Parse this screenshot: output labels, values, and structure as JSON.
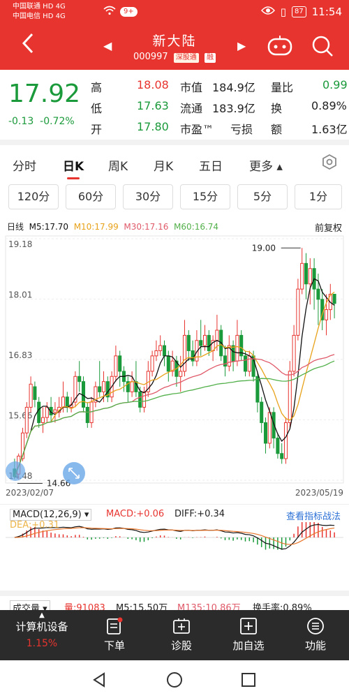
{
  "status": {
    "carrier1": "中国联通 HD 4G",
    "carrier2": "中国电信 HD 4G",
    "notif_badge": "9+",
    "battery": "87",
    "time": "11:54"
  },
  "header": {
    "back_icon": "back-arrow-icon",
    "title": "新大陆",
    "code": "000997",
    "tag_sgt": "深股通",
    "tag_rong": "融"
  },
  "quote": {
    "price": "17.92",
    "change": "-0.13",
    "change_pct": "-0.72%",
    "high_label": "高",
    "high": "18.08",
    "low_label": "低",
    "low": "17.63",
    "open_label": "开",
    "open": "17.80",
    "mcap_label": "市值",
    "mcap": "184.9亿",
    "float_label": "流通",
    "float": "183.9亿",
    "pe_label": "市盈™",
    "pe": "亏损",
    "vr_label": "量比",
    "vr": "0.99",
    "turn_label": "换",
    "turn": "0.89%",
    "amt_label": "额",
    "amt": "1.63亿"
  },
  "tabs": [
    "分时",
    "日K",
    "周K",
    "月K",
    "五日",
    "更多 ▴"
  ],
  "periods": [
    "120分",
    "60分",
    "30分",
    "15分",
    "5分",
    "1分"
  ],
  "ma": {
    "title": "日线",
    "m5": "M5:17.70",
    "m10": "M10:17.99",
    "m30": "M30:17.16",
    "m60": "M60:16.74",
    "qfq": "前复权",
    "c_m5": "#111111",
    "c_m10": "#e8a21a",
    "c_m30": "#e05a6a",
    "c_m60": "#52b04a"
  },
  "chart_data": {
    "type": "candlestick",
    "y_ticks": [
      "19.18",
      "18.01",
      "16.83",
      "15.66",
      "14.48"
    ],
    "ylim": [
      14.48,
      19.18
    ],
    "max_label": "19.00",
    "min_label": "14.66",
    "start_date": "2023/02/07",
    "end_date": "2023/05/19",
    "candles": [
      [
        14.7,
        14.55,
        14.9,
        14.5
      ],
      [
        14.6,
        14.95,
        15.0,
        14.5
      ],
      [
        14.9,
        15.4,
        15.5,
        14.85
      ],
      [
        15.4,
        15.9,
        16.0,
        15.3
      ],
      [
        15.9,
        16.35,
        16.5,
        15.8
      ],
      [
        16.3,
        16.05,
        16.4,
        15.9
      ],
      [
        16.0,
        15.6,
        16.1,
        15.5
      ],
      [
        15.6,
        15.7,
        15.9,
        15.4
      ],
      [
        15.7,
        15.9,
        16.0,
        15.6
      ],
      [
        15.9,
        15.75,
        16.1,
        15.6
      ],
      [
        15.8,
        15.85,
        16.0,
        15.6
      ],
      [
        15.8,
        15.9,
        16.1,
        15.7
      ],
      [
        15.9,
        16.1,
        16.4,
        15.8
      ],
      [
        16.1,
        15.9,
        16.2,
        15.8
      ],
      [
        15.9,
        15.95,
        16.1,
        15.8
      ],
      [
        16.0,
        16.5,
        16.6,
        15.9
      ],
      [
        16.5,
        16.4,
        16.8,
        16.2
      ],
      [
        16.4,
        15.9,
        16.5,
        15.8
      ],
      [
        15.9,
        15.6,
        16.0,
        15.5
      ],
      [
        15.6,
        16.0,
        16.1,
        15.5
      ],
      [
        16.0,
        16.3,
        16.4,
        15.9
      ],
      [
        16.3,
        16.2,
        16.8,
        16.1
      ],
      [
        16.2,
        16.4,
        16.6,
        16.0
      ],
      [
        16.4,
        16.1,
        16.5,
        16.0
      ],
      [
        16.1,
        16.5,
        16.6,
        16.0
      ],
      [
        16.5,
        16.9,
        17.1,
        16.4
      ],
      [
        16.9,
        16.6,
        17.0,
        16.3
      ],
      [
        16.6,
        16.4,
        16.7,
        16.2
      ],
      [
        16.4,
        16.2,
        16.5,
        16.0
      ],
      [
        16.2,
        16.4,
        16.6,
        16.1
      ],
      [
        16.4,
        16.2,
        16.8,
        16.1
      ],
      [
        16.2,
        15.9,
        16.3,
        15.8
      ],
      [
        15.9,
        16.2,
        16.3,
        15.8
      ],
      [
        16.2,
        16.6,
        16.8,
        16.1
      ],
      [
        16.6,
        16.9,
        17.0,
        16.5
      ],
      [
        16.9,
        17.0,
        17.2,
        16.8
      ],
      [
        17.0,
        17.1,
        17.3,
        16.9
      ],
      [
        17.1,
        16.9,
        17.2,
        16.7
      ],
      [
        16.9,
        16.6,
        17.0,
        16.4
      ],
      [
        16.6,
        16.8,
        17.0,
        16.5
      ],
      [
        16.8,
        16.5,
        16.9,
        16.3
      ],
      [
        16.5,
        16.6,
        16.9,
        16.2
      ],
      [
        16.6,
        17.3,
        17.6,
        16.5
      ],
      [
        17.3,
        17.0,
        17.4,
        16.8
      ],
      [
        17.0,
        16.8,
        17.2,
        16.7
      ],
      [
        16.8,
        17.2,
        17.4,
        16.7
      ],
      [
        17.2,
        17.1,
        17.6,
        16.9
      ],
      [
        17.1,
        17.3,
        17.5,
        17.0
      ],
      [
        17.3,
        17.0,
        17.4,
        16.9
      ],
      [
        17.0,
        17.2,
        17.3,
        16.8
      ],
      [
        17.2,
        17.4,
        17.7,
        17.0
      ],
      [
        17.4,
        16.9,
        17.5,
        16.8
      ],
      [
        16.9,
        16.7,
        17.1,
        16.5
      ],
      [
        16.7,
        17.1,
        17.3,
        16.6
      ],
      [
        17.1,
        16.8,
        17.2,
        16.6
      ],
      [
        16.8,
        17.3,
        17.6,
        16.7
      ],
      [
        17.3,
        16.9,
        17.4,
        16.8
      ],
      [
        16.9,
        16.6,
        17.0,
        16.5
      ],
      [
        16.6,
        16.9,
        17.0,
        16.5
      ],
      [
        16.9,
        16.5,
        17.0,
        16.4
      ],
      [
        16.5,
        16.0,
        16.6,
        15.8
      ],
      [
        16.0,
        15.6,
        16.1,
        15.4
      ],
      [
        15.6,
        15.2,
        15.7,
        15.0
      ],
      [
        15.2,
        15.8,
        15.9,
        15.1
      ],
      [
        15.8,
        15.3,
        15.9,
        15.1
      ],
      [
        15.3,
        15.0,
        15.4,
        14.9
      ],
      [
        15.0,
        14.9,
        15.2,
        14.8
      ],
      [
        14.9,
        15.6,
        15.7,
        14.8
      ],
      [
        15.6,
        16.6,
        16.8,
        15.5
      ],
      [
        16.6,
        17.3,
        17.5,
        16.5
      ],
      [
        17.3,
        18.2,
        18.4,
        17.2
      ],
      [
        18.2,
        18.7,
        19.0,
        18.1
      ],
      [
        18.7,
        18.3,
        18.9,
        18.0
      ],
      [
        18.3,
        18.6,
        18.8,
        17.9
      ],
      [
        18.6,
        18.2,
        18.8,
        17.8
      ],
      [
        18.2,
        18.0,
        18.5,
        17.5
      ],
      [
        18.0,
        17.6,
        18.2,
        17.4
      ],
      [
        17.6,
        17.8,
        18.1,
        17.3
      ],
      [
        17.8,
        18.1,
        18.3,
        17.6
      ],
      [
        18.1,
        17.92,
        18.08,
        17.63
      ]
    ]
  },
  "macd": {
    "name": "MACD(12,26,9)",
    "macd": "MACD:+0.06",
    "diff": "DIFF:+0.34",
    "dea": "DEA:+0.31",
    "link": "查看指标战法"
  },
  "vol": {
    "name": "成交量",
    "liang": "量:91083",
    "m5": "M5:15.50万",
    "m135": "M135:10.86万",
    "turnover": "换手率:0.89%"
  },
  "bottom": {
    "sector": "计算机设备",
    "sector_pct": "1.15%",
    "order": "下单",
    "diag": "诊股",
    "add": "加自选",
    "func": "功能"
  }
}
